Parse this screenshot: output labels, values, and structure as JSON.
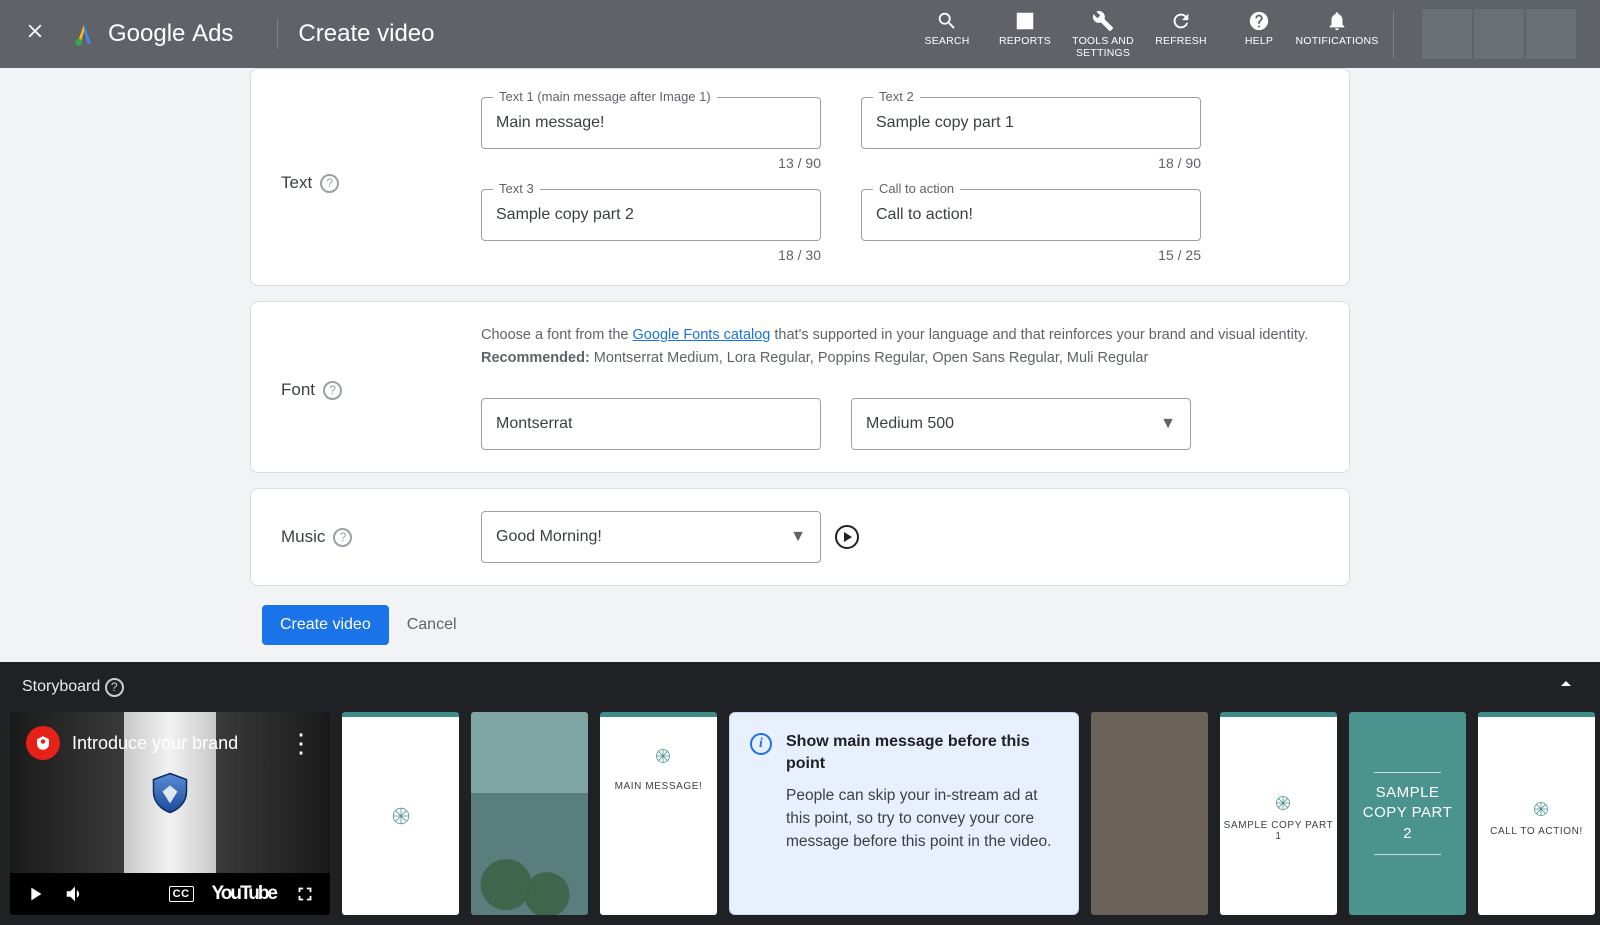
{
  "header": {
    "brand": "Google",
    "brand_suffix": "Ads",
    "page_title": "Create video",
    "actions": {
      "search": "SEARCH",
      "reports": "REPORTS",
      "tools": "TOOLS AND SETTINGS",
      "refresh": "REFRESH",
      "help": "HELP",
      "notifications": "NOTIFICATIONS"
    }
  },
  "text_section": {
    "label": "Text",
    "text1": {
      "label": "Text 1 (main message after Image 1)",
      "value": "Main message!",
      "counter": "13 / 90"
    },
    "text2": {
      "label": "Text 2",
      "value": "Sample copy part 1",
      "counter": "18 / 90"
    },
    "text3": {
      "label": "Text 3",
      "value": "Sample copy part 2",
      "counter": "18 / 30"
    },
    "cta": {
      "label": "Call to action",
      "value": "Call to action!",
      "counter": "15 / 25"
    }
  },
  "font_section": {
    "label": "Font",
    "desc_pre": "Choose a font from the ",
    "desc_link": "Google Fonts catalog",
    "desc_post": " that's supported in your language and that reinforces your brand and visual identity.",
    "recommended_label": "Recommended:",
    "recommended_list": " Montserrat Medium, Lora Regular, Poppins Regular, Open Sans Regular, Muli Regular",
    "family": "Montserrat",
    "weight": "Medium 500"
  },
  "music_section": {
    "label": "Music",
    "track": "Good Morning!"
  },
  "buttons": {
    "create": "Create video",
    "cancel": "Cancel"
  },
  "storyboard": {
    "label": "Storyboard",
    "preview_title": "Introduce your brand",
    "youtube": "YouTube",
    "cc": "CC",
    "frame_main_message": "MAIN MESSAGE!",
    "notice_title": "Show main message before this point",
    "notice_body": "People can skip your in-stream ad at this point, so try to convey your core message before this point in the video.",
    "frame_copy1": "SAMPLE COPY PART 1",
    "frame_copy2": "SAMPLE COPY PART 2",
    "frame_cta": "CALL TO ACTION!"
  }
}
